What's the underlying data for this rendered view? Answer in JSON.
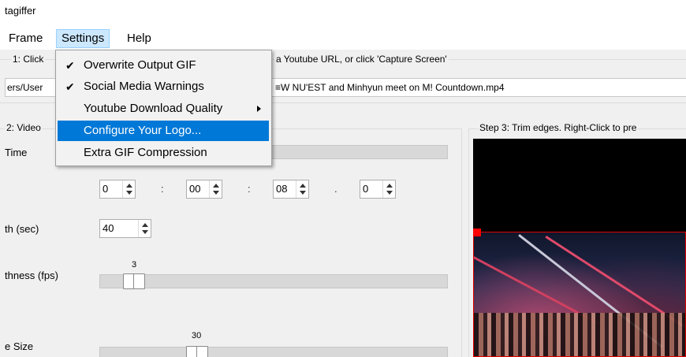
{
  "window": {
    "title": "tagiffer"
  },
  "menubar": {
    "items": [
      {
        "label": "Frame"
      },
      {
        "label": "Settings"
      },
      {
        "label": "Help"
      }
    ]
  },
  "settings_menu": {
    "items": [
      {
        "label": "Overwrite Output GIF",
        "check": "✔"
      },
      {
        "label": "Social Media Warnings",
        "check": "✔"
      },
      {
        "label": "Youtube Download Quality",
        "check": ""
      },
      {
        "label": "Configure Your Logo...",
        "check": ""
      },
      {
        "label": "Extra GIF Compression",
        "check": ""
      }
    ],
    "highlight_color": "#0078d7"
  },
  "step1": {
    "label_left": "1: Click",
    "label_right": "a Youtube URL, or click 'Capture Screen'",
    "path_left": "ers/User",
    "path_right": "≡W NU'EST and Minhyun meet on M! Countdown.mp4"
  },
  "step2": {
    "label": "2: Video",
    "time_label": "Time",
    "time_fields": [
      "0",
      "00",
      "08",
      "0"
    ],
    "time_separators": [
      ":",
      ":",
      "."
    ],
    "length_label": "th (sec)",
    "length_value": "40",
    "smoothness_label": "thness (fps)",
    "smoothness_value": "3",
    "size_label": "e Size",
    "size_value": "30"
  },
  "step3": {
    "label": "Step 3: Trim edges. Right-Click to pre"
  },
  "colors": {
    "crop_handle": "#ff0000",
    "menu_hover": "#cce8ff"
  }
}
